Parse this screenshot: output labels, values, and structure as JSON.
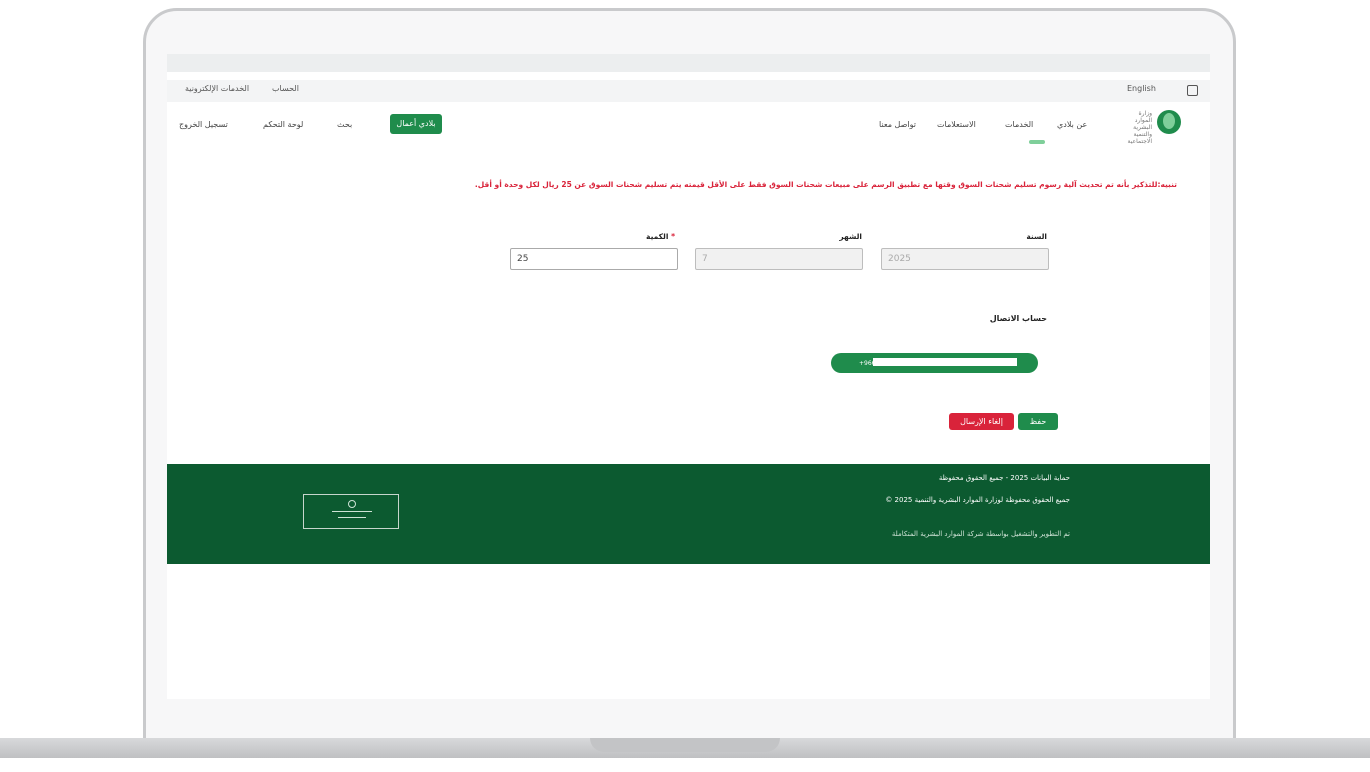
{
  "utility_bar": {
    "left_item": "الخدمات الإلكترونية",
    "left_item_2": "الحساب",
    "right_item": "English"
  },
  "header": {
    "logo_text": "وزارة الموارد البشرية والتنمية الاجتماعية",
    "nav_items": [
      "عن بلادي",
      "الخدمات",
      "الاستعلامات",
      "تواصل معنا"
    ],
    "business_button": "بلادي أعمال",
    "search_label": "بحث",
    "dashboard_label": "لوحة التحكم",
    "logout_label": "تسجيل الخروج"
  },
  "notice": "تنبيه:للتذكير بأنه تم تحديث آلية رسوم تسليم شحنات السوق وقتها مع تطبيق الرسم على مبيعات شحنات السوق فقط على الأقل قيمته يتم تسليم شحنات السوق عن 25 ريال لكل وحدة أو أقل.",
  "form": {
    "year_label": "السنة",
    "year_value": "2025",
    "month_label": "الشهر",
    "month_value": "7",
    "quantity_label": "الكمية",
    "quantity_required_mark": "*",
    "quantity_value": "25",
    "contact_section_title": "حساب الاتصال",
    "contact_pill_text": "+966..."
  },
  "actions": {
    "submit_label": "حفظ",
    "cancel_label": "إلغاء الإرسال"
  },
  "footer": {
    "line1": "حماية البيانات 2025 - جميع الحقوق محفوظة",
    "line2": "جميع الحقوق محفوظة لوزارة الموارد البشرية والتنمية 2025 ©",
    "line3": "تم التطوير والتشغيل بواسطة شركة الموارد البشرية المتكاملة"
  },
  "colors": {
    "brand_green": "#1f8c4c",
    "footer_green": "#0c5a30",
    "alert_red": "#d9233a"
  }
}
